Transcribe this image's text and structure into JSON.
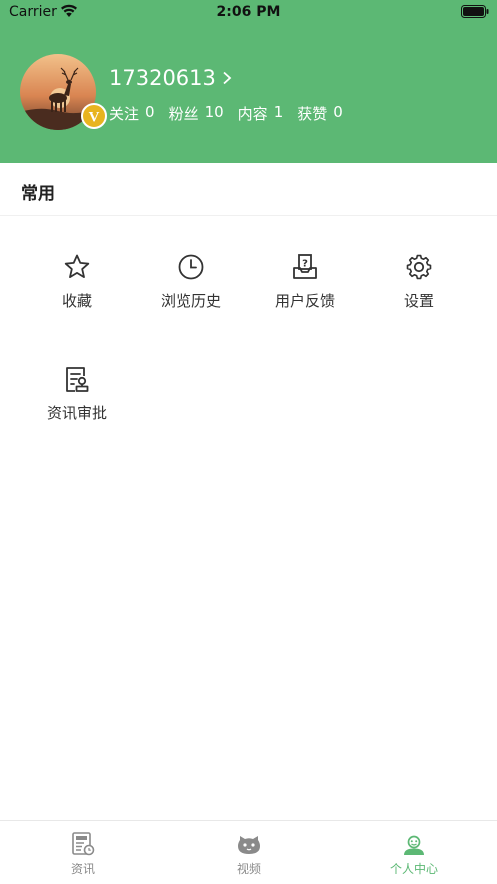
{
  "status_bar": {
    "carrier": "Carrier",
    "time": "2:06 PM",
    "wifi_icon": "wifi-icon",
    "battery_icon": "battery-icon"
  },
  "profile": {
    "user_id": "17320613",
    "badge_text": "V",
    "stats": [
      {
        "label": "关注",
        "value": "0"
      },
      {
        "label": "粉丝",
        "value": "10"
      },
      {
        "label": "内容",
        "value": "1"
      },
      {
        "label": "获赞",
        "value": "0"
      }
    ]
  },
  "section": {
    "title": "常用"
  },
  "features": [
    {
      "label": "收藏",
      "icon": "star-icon"
    },
    {
      "label": "浏览历史",
      "icon": "clock-icon"
    },
    {
      "label": "用户反馈",
      "icon": "feedback-icon"
    },
    {
      "label": "设置",
      "icon": "gear-icon"
    },
    {
      "label": "资讯审批",
      "icon": "approval-icon"
    }
  ],
  "tabbar": {
    "tabs": [
      {
        "label": "资讯",
        "icon": "news-icon",
        "active": false
      },
      {
        "label": "视频",
        "icon": "video-icon",
        "active": false
      },
      {
        "label": "个人中心",
        "icon": "profile-icon",
        "active": true
      }
    ]
  },
  "colors": {
    "header_bg": "#5cb874",
    "active_tab": "#5cb874",
    "inactive_tab": "#8a8a8a",
    "badge": "#e8b41f"
  }
}
